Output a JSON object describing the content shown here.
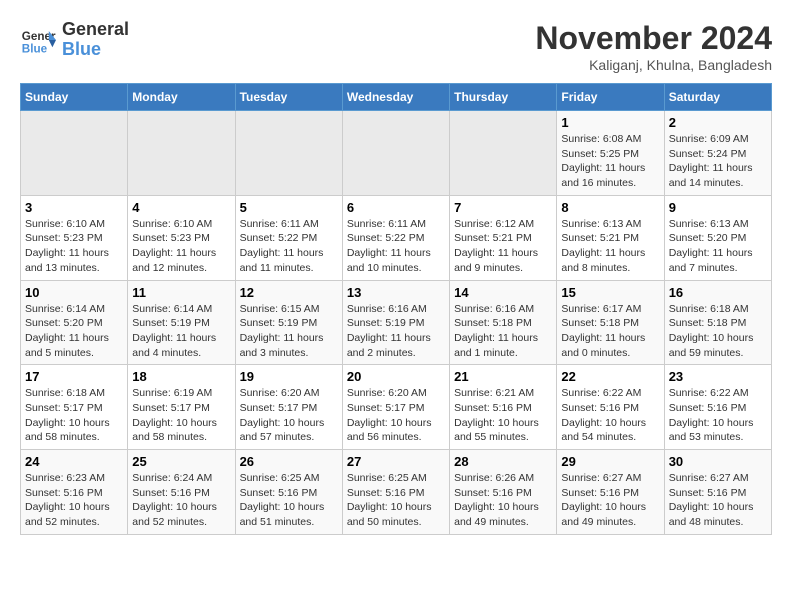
{
  "logo": {
    "line1": "General",
    "line2": "Blue"
  },
  "title": "November 2024",
  "location": "Kaliganj, Khulna, Bangladesh",
  "weekdays": [
    "Sunday",
    "Monday",
    "Tuesday",
    "Wednesday",
    "Thursday",
    "Friday",
    "Saturday"
  ],
  "weeks": [
    [
      {
        "day": "",
        "info": ""
      },
      {
        "day": "",
        "info": ""
      },
      {
        "day": "",
        "info": ""
      },
      {
        "day": "",
        "info": ""
      },
      {
        "day": "",
        "info": ""
      },
      {
        "day": "1",
        "info": "Sunrise: 6:08 AM\nSunset: 5:25 PM\nDaylight: 11 hours and 16 minutes."
      },
      {
        "day": "2",
        "info": "Sunrise: 6:09 AM\nSunset: 5:24 PM\nDaylight: 11 hours and 14 minutes."
      }
    ],
    [
      {
        "day": "3",
        "info": "Sunrise: 6:10 AM\nSunset: 5:23 PM\nDaylight: 11 hours and 13 minutes."
      },
      {
        "day": "4",
        "info": "Sunrise: 6:10 AM\nSunset: 5:23 PM\nDaylight: 11 hours and 12 minutes."
      },
      {
        "day": "5",
        "info": "Sunrise: 6:11 AM\nSunset: 5:22 PM\nDaylight: 11 hours and 11 minutes."
      },
      {
        "day": "6",
        "info": "Sunrise: 6:11 AM\nSunset: 5:22 PM\nDaylight: 11 hours and 10 minutes."
      },
      {
        "day": "7",
        "info": "Sunrise: 6:12 AM\nSunset: 5:21 PM\nDaylight: 11 hours and 9 minutes."
      },
      {
        "day": "8",
        "info": "Sunrise: 6:13 AM\nSunset: 5:21 PM\nDaylight: 11 hours and 8 minutes."
      },
      {
        "day": "9",
        "info": "Sunrise: 6:13 AM\nSunset: 5:20 PM\nDaylight: 11 hours and 7 minutes."
      }
    ],
    [
      {
        "day": "10",
        "info": "Sunrise: 6:14 AM\nSunset: 5:20 PM\nDaylight: 11 hours and 5 minutes."
      },
      {
        "day": "11",
        "info": "Sunrise: 6:14 AM\nSunset: 5:19 PM\nDaylight: 11 hours and 4 minutes."
      },
      {
        "day": "12",
        "info": "Sunrise: 6:15 AM\nSunset: 5:19 PM\nDaylight: 11 hours and 3 minutes."
      },
      {
        "day": "13",
        "info": "Sunrise: 6:16 AM\nSunset: 5:19 PM\nDaylight: 11 hours and 2 minutes."
      },
      {
        "day": "14",
        "info": "Sunrise: 6:16 AM\nSunset: 5:18 PM\nDaylight: 11 hours and 1 minute."
      },
      {
        "day": "15",
        "info": "Sunrise: 6:17 AM\nSunset: 5:18 PM\nDaylight: 11 hours and 0 minutes."
      },
      {
        "day": "16",
        "info": "Sunrise: 6:18 AM\nSunset: 5:18 PM\nDaylight: 10 hours and 59 minutes."
      }
    ],
    [
      {
        "day": "17",
        "info": "Sunrise: 6:18 AM\nSunset: 5:17 PM\nDaylight: 10 hours and 58 minutes."
      },
      {
        "day": "18",
        "info": "Sunrise: 6:19 AM\nSunset: 5:17 PM\nDaylight: 10 hours and 58 minutes."
      },
      {
        "day": "19",
        "info": "Sunrise: 6:20 AM\nSunset: 5:17 PM\nDaylight: 10 hours and 57 minutes."
      },
      {
        "day": "20",
        "info": "Sunrise: 6:20 AM\nSunset: 5:17 PM\nDaylight: 10 hours and 56 minutes."
      },
      {
        "day": "21",
        "info": "Sunrise: 6:21 AM\nSunset: 5:16 PM\nDaylight: 10 hours and 55 minutes."
      },
      {
        "day": "22",
        "info": "Sunrise: 6:22 AM\nSunset: 5:16 PM\nDaylight: 10 hours and 54 minutes."
      },
      {
        "day": "23",
        "info": "Sunrise: 6:22 AM\nSunset: 5:16 PM\nDaylight: 10 hours and 53 minutes."
      }
    ],
    [
      {
        "day": "24",
        "info": "Sunrise: 6:23 AM\nSunset: 5:16 PM\nDaylight: 10 hours and 52 minutes."
      },
      {
        "day": "25",
        "info": "Sunrise: 6:24 AM\nSunset: 5:16 PM\nDaylight: 10 hours and 52 minutes."
      },
      {
        "day": "26",
        "info": "Sunrise: 6:25 AM\nSunset: 5:16 PM\nDaylight: 10 hours and 51 minutes."
      },
      {
        "day": "27",
        "info": "Sunrise: 6:25 AM\nSunset: 5:16 PM\nDaylight: 10 hours and 50 minutes."
      },
      {
        "day": "28",
        "info": "Sunrise: 6:26 AM\nSunset: 5:16 PM\nDaylight: 10 hours and 49 minutes."
      },
      {
        "day": "29",
        "info": "Sunrise: 6:27 AM\nSunset: 5:16 PM\nDaylight: 10 hours and 49 minutes."
      },
      {
        "day": "30",
        "info": "Sunrise: 6:27 AM\nSunset: 5:16 PM\nDaylight: 10 hours and 48 minutes."
      }
    ]
  ]
}
